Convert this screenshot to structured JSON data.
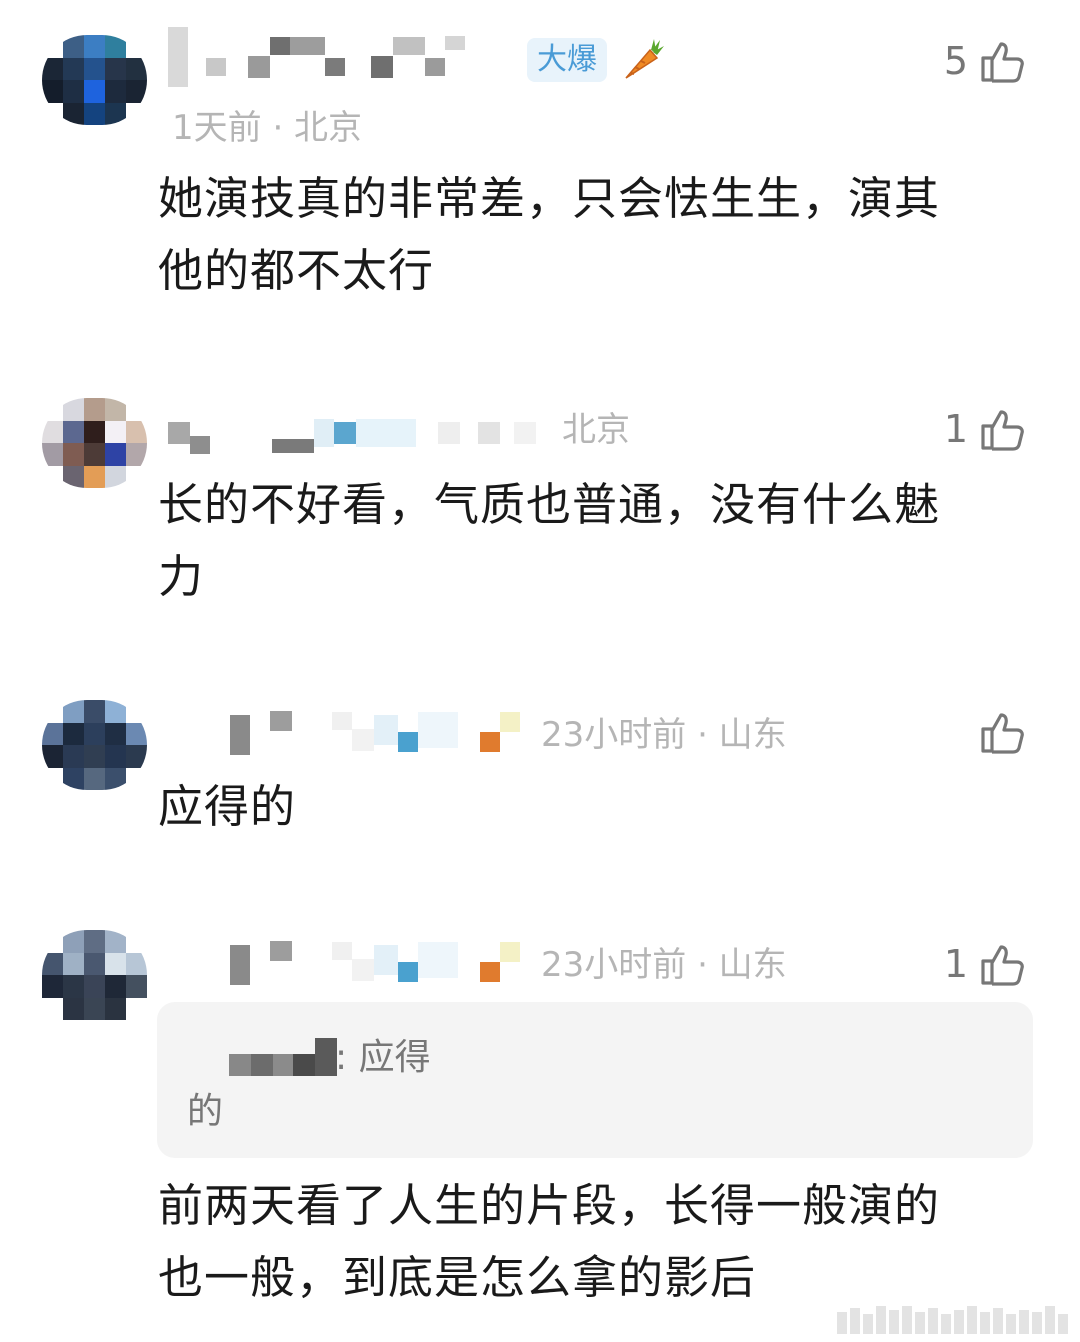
{
  "comments": [
    {
      "badge": "大爆",
      "meta": "1天前 · 北京",
      "likes": "5",
      "text_line1": "她演技真的非常差，只会怯生生，演其",
      "text_line2": "他的都不太行"
    },
    {
      "meta": "北京",
      "likes": "1",
      "text_line1": "长的不好看，气质也普通，没有什么魅",
      "text_line2": "力"
    },
    {
      "meta": "23小时前 · 山东",
      "likes": "",
      "text_line1": "应得的"
    },
    {
      "meta": "23小时前 · 山东",
      "likes": "1",
      "quote_line1": ": 应得",
      "quote_line2": "的",
      "text_line1": "前两天看了人生的片段，长得一般演的",
      "text_line2": "也一般，到底是怎么拿的影后"
    }
  ],
  "icons": {
    "like": "thumbs-up-icon",
    "carrot": "carrot-icon"
  },
  "colors": {
    "meta_gray": "#b5b5b5",
    "text": "#1a1a1a",
    "badge_blue": "#4a9bd6",
    "quote_bg": "#f4f4f4"
  }
}
